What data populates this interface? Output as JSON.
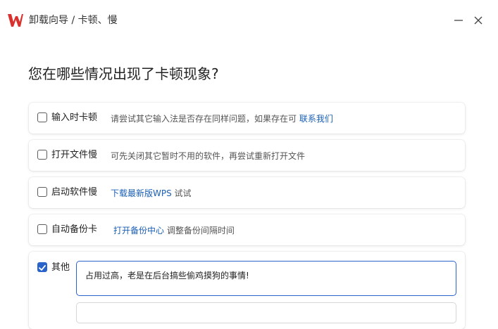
{
  "window": {
    "title": "卸载向导 / 卡顿、慢",
    "brand_color": "#d9322e",
    "accent_color": "#2a63c9"
  },
  "heading": "您在哪些情况出现了卡顿现象?",
  "options": [
    {
      "label": "输入时卡顿",
      "checked": false,
      "desc_text": "请尝试其它输入法是否存在同样问题，如果存在可",
      "desc_link": "联系我们",
      "desc_after": ""
    },
    {
      "label": "打开文件慢",
      "checked": false,
      "desc_text": "可先关闭其它暂时不用的软件，再尝试重新打开文件",
      "desc_link": "",
      "desc_after": ""
    },
    {
      "label": "启动软件慢",
      "checked": false,
      "desc_text": "",
      "desc_link": "下载最新版WPS",
      "desc_after": " 试试"
    },
    {
      "label": "自动备份卡",
      "checked": false,
      "desc_text": "",
      "desc_link": "打开备份中心",
      "desc_after": " 调整备份间隔时间"
    }
  ],
  "other": {
    "label": "其他",
    "checked": true,
    "input_value": "占用过高，老是在后台搞些偷鸡摸狗的事情!"
  },
  "icons": {
    "logo": "wps-logo-icon",
    "minimize": "minimize-icon",
    "close": "close-icon",
    "check": "checkmark-icon"
  }
}
